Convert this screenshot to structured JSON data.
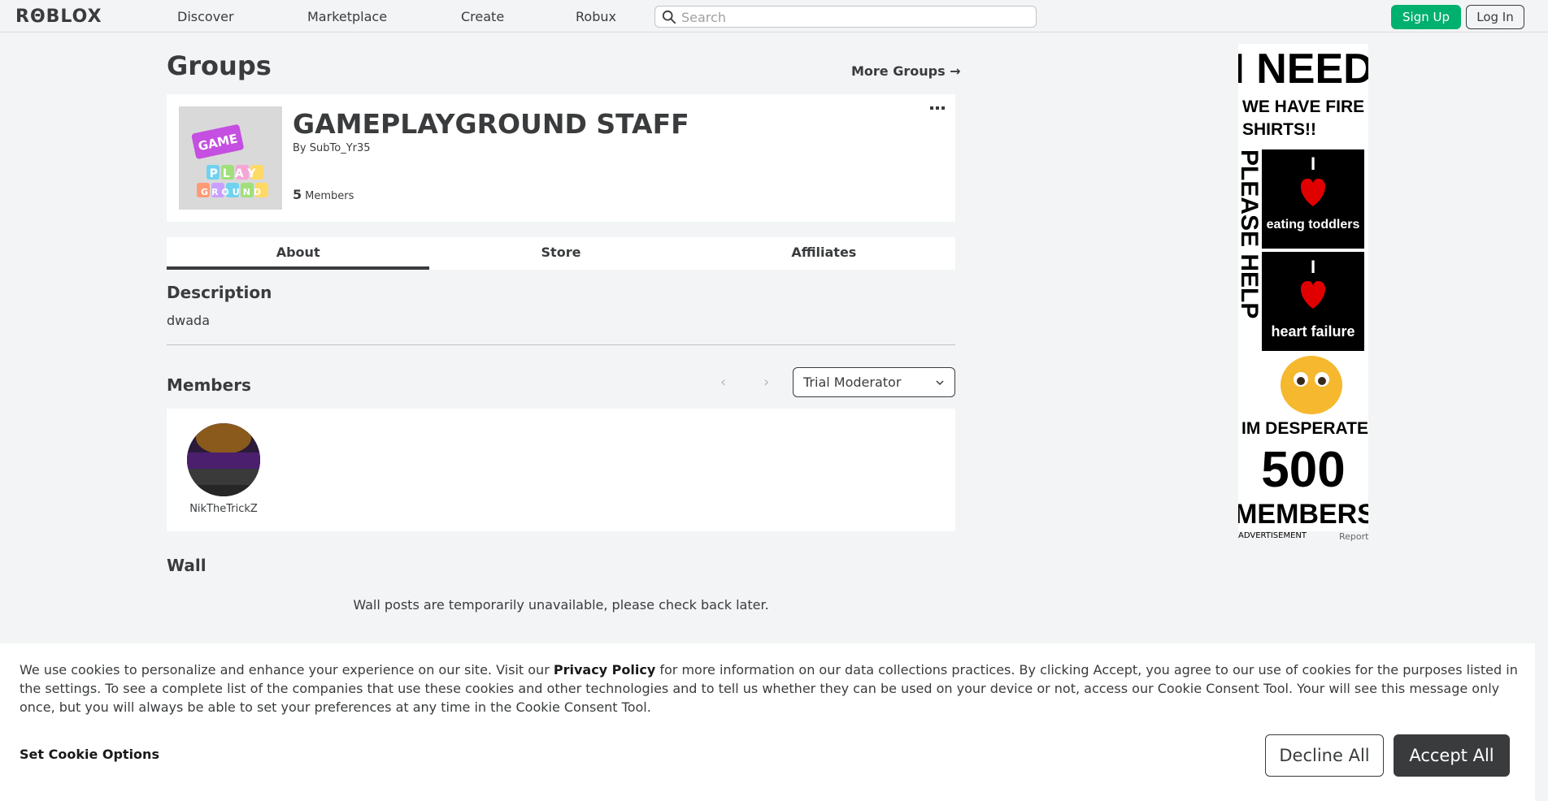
{
  "topbar": {
    "logo": "RΘBLOX",
    "nav": [
      "Discover",
      "Marketplace",
      "Create",
      "Robux"
    ],
    "search_placeholder": "Search",
    "signup_label": "Sign Up",
    "login_label": "Log In"
  },
  "page": {
    "title": "Groups",
    "more_groups_label": "More Groups →"
  },
  "group": {
    "name": "GAMEPLAYGROUND STAFF",
    "by_prefix": "By",
    "owner": "SubTo_Yr35",
    "member_count": "5",
    "members_label": "Members",
    "emblem_text": [
      "GAME",
      "PLAY",
      "GROUND"
    ]
  },
  "tabs": [
    {
      "label": "About",
      "active": true
    },
    {
      "label": "Store",
      "active": false
    },
    {
      "label": "Affiliates",
      "active": false
    }
  ],
  "about": {
    "description_title": "Description",
    "description_text": "dwada"
  },
  "members": {
    "title": "Members",
    "selected_role": "Trial Moderator",
    "list": [
      {
        "name": "NikTheTrickZ"
      }
    ]
  },
  "wall": {
    "title": "Wall",
    "message": "Wall posts are temporarily unavailable, please check back later."
  },
  "ad": {
    "lines": [
      "I NEED",
      "WE HAVE FIRE",
      "SHIRTS!!",
      "PLEASE HELP",
      "I",
      "eating toddlers",
      "I",
      "heart failure",
      "IM DESPERATE",
      "500",
      "MEMBERS"
    ],
    "label": "ADVERTISEMENT",
    "report": "Report"
  },
  "cookie": {
    "text_before": "We use cookies to personalize and enhance your experience on our site. Visit our ",
    "privacy_link": "Privacy Policy",
    "text_after": " for more information on our data collections practices. By clicking Accept, you agree to our use of cookies for the purposes listed in the settings. To see a complete list of the companies that use these cookies and other technologies and to tell us whether they can be used on your device or not, access our Cookie Consent Tool. Your will see this message only once, but you will always be able to set your preferences at any time in the Cookie Consent Tool.",
    "options_label": "Set Cookie Options",
    "decline_label": "Decline All",
    "accept_label": "Accept All"
  },
  "colors": {
    "signup": "#00b06f",
    "accent_dark": "#393b3d",
    "background": "#f2f4f5"
  }
}
